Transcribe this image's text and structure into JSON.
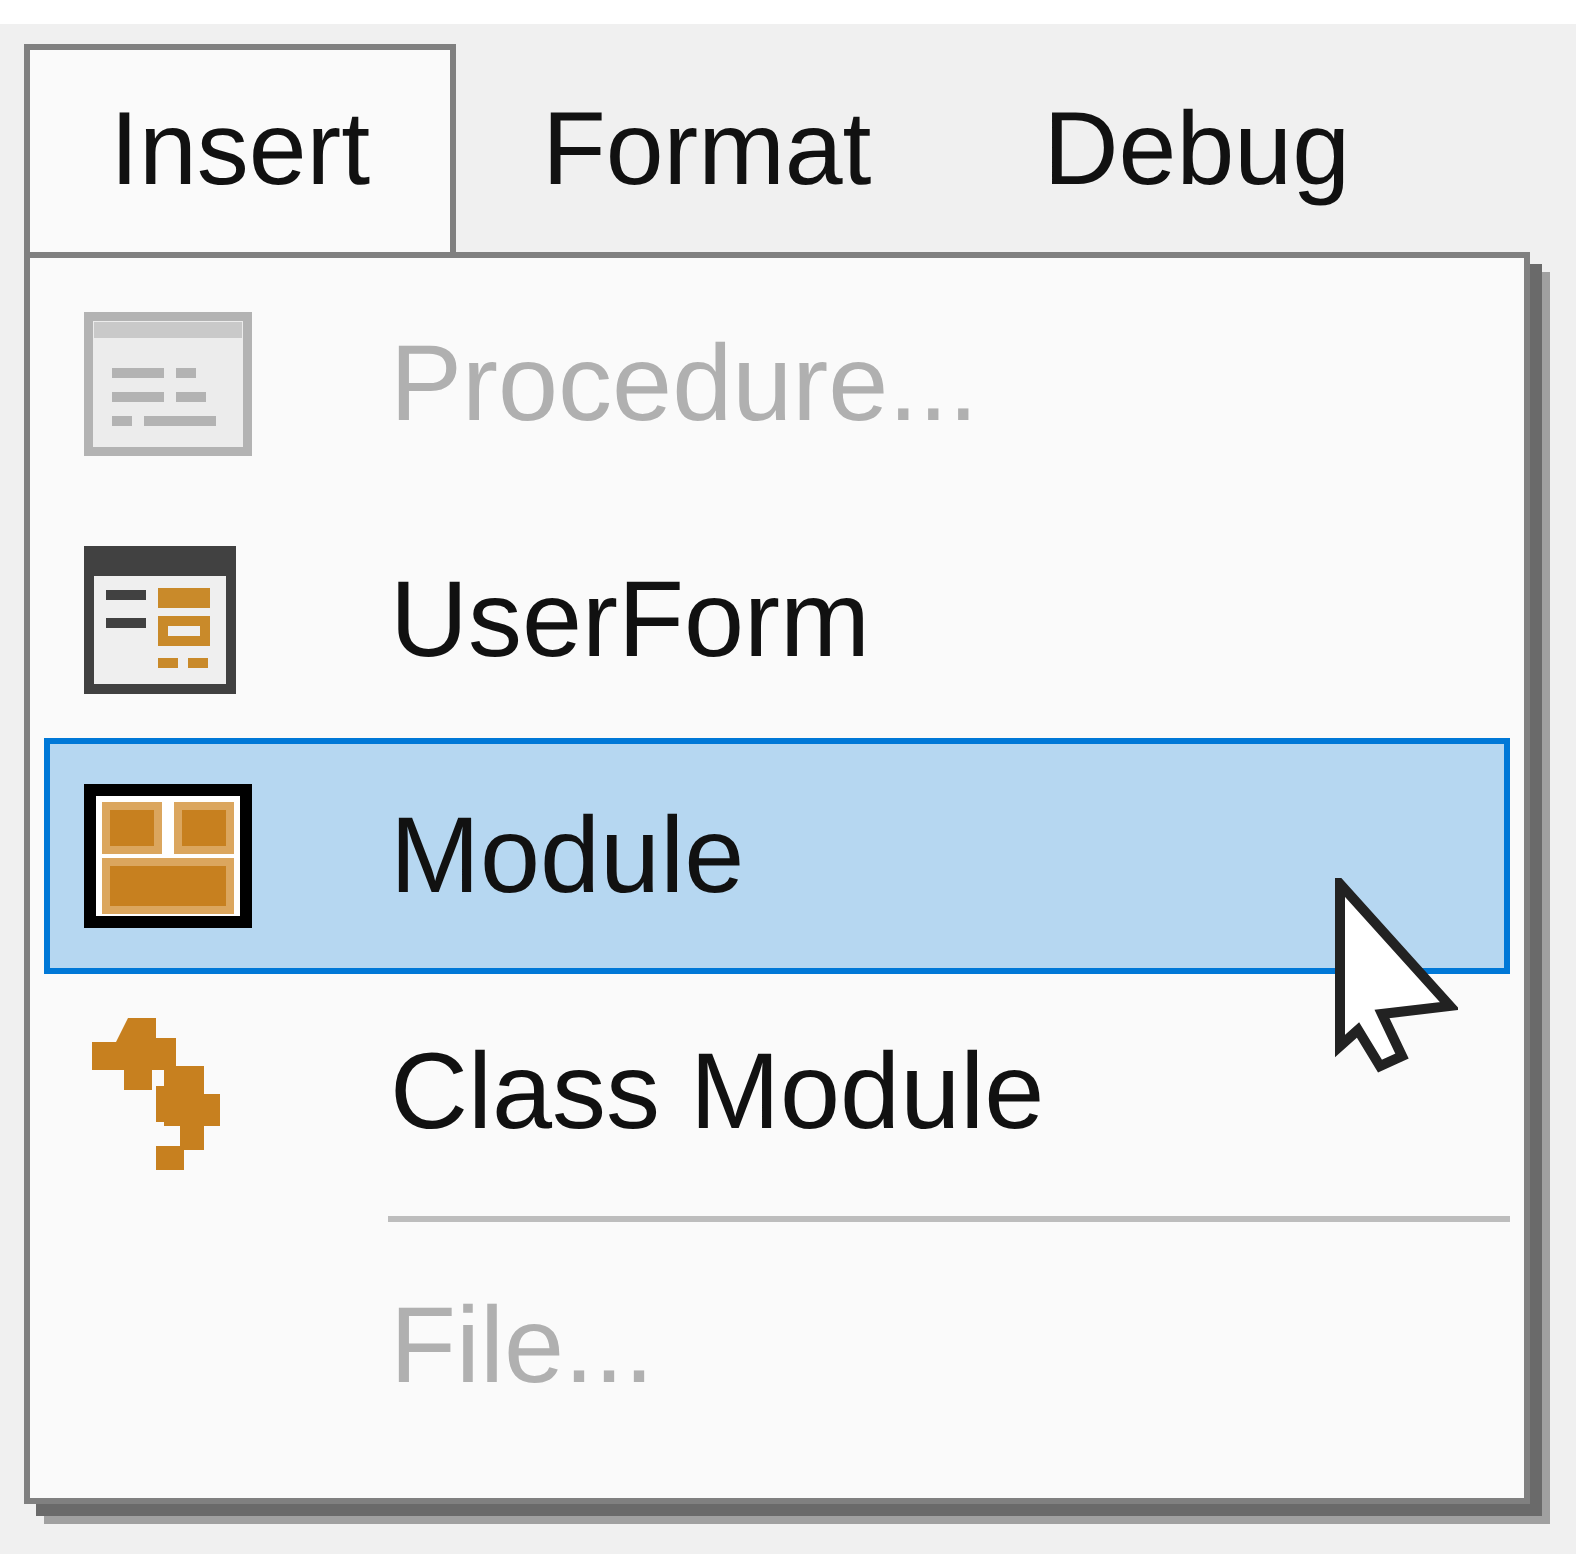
{
  "menu_bar": [
    {
      "label": "Insert",
      "selected": true
    },
    {
      "label": "Format",
      "selected": false
    },
    {
      "label": "Debug",
      "selected": false
    }
  ],
  "menu": {
    "items": [
      {
        "kind": "item",
        "label": "Procedure...",
        "disabled": true,
        "selected": false
      },
      {
        "kind": "item",
        "label": "UserForm",
        "disabled": false,
        "selected": false
      },
      {
        "kind": "item",
        "label": "Module",
        "disabled": false,
        "selected": true
      },
      {
        "kind": "item",
        "label": "Class Module",
        "disabled": false,
        "selected": false
      },
      {
        "kind": "separator"
      },
      {
        "kind": "item",
        "label": "File...",
        "disabled": true,
        "selected": false
      }
    ]
  }
}
